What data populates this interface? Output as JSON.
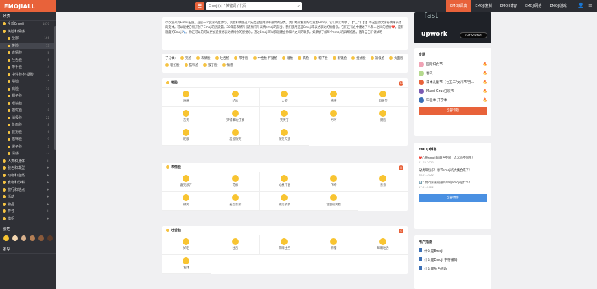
{
  "header": {
    "logo": "EMOJIALL",
    "search_placeholder": "Emoji(s) / 关键词 / 代码",
    "nav": [
      "EMOJI词典",
      "EMOJI复制",
      "EMOJI博客",
      "EMOJI网络",
      "EMOJI游戏"
    ]
  },
  "sidebar": {
    "section_title": "分类",
    "items": [
      {
        "label": "全部Emoji",
        "count": "1870",
        "type": "top"
      },
      {
        "label": "笑脸和情感",
        "count": "",
        "type": "top"
      },
      {
        "label": "全部",
        "count": "166",
        "type": "sub"
      },
      {
        "label": "笑脸",
        "count": "13",
        "type": "sub"
      },
      {
        "label": "表情脸",
        "count": "8",
        "type": "sub"
      },
      {
        "label": "吐舌脸",
        "count": "6",
        "type": "sub"
      },
      {
        "label": "带手脸",
        "count": "4",
        "type": "sub"
      },
      {
        "label": "中性脸-怀疑脸",
        "count": "12",
        "type": "sub"
      },
      {
        "label": "睡脸",
        "count": "5",
        "type": "sub"
      },
      {
        "label": "病脸",
        "count": "10",
        "type": "sub"
      },
      {
        "label": "帽子脸",
        "count": "1",
        "type": "sub"
      },
      {
        "label": "眼镜脸",
        "count": "3",
        "type": "sub"
      },
      {
        "label": "担忧脸",
        "count": "8",
        "type": "sub"
      },
      {
        "label": "消极脸",
        "count": "22",
        "type": "sub"
      },
      {
        "label": "负面脸",
        "count": "8",
        "type": "sub"
      },
      {
        "label": "装扮脸",
        "count": "6",
        "type": "sub"
      },
      {
        "label": "猫咪脸",
        "count": "9",
        "type": "sub"
      },
      {
        "label": "猴子脸",
        "count": "3",
        "type": "sub"
      },
      {
        "label": "情感",
        "count": "37",
        "type": "sub"
      },
      {
        "label": "人类和身体",
        "count": "",
        "type": "top"
      },
      {
        "label": "肤色和发型",
        "count": "",
        "type": "top"
      },
      {
        "label": "动物和自然",
        "count": "",
        "type": "top"
      },
      {
        "label": "食物和饮料",
        "count": "",
        "type": "top"
      },
      {
        "label": "旅行和地点",
        "count": "",
        "type": "top"
      },
      {
        "label": "活动",
        "count": "",
        "type": "top"
      },
      {
        "label": "物品",
        "count": "",
        "type": "top"
      },
      {
        "label": "符号",
        "count": "",
        "type": "top"
      },
      {
        "label": "旗帜",
        "count": "",
        "type": "top"
      }
    ],
    "skin_title": "肤色",
    "hair_title": "发型",
    "skin_colors": [
      "#f8c431",
      "#f3d6b0",
      "#d8b08c",
      "#b57f55",
      "#8a5a3b",
      "#5b3a29"
    ]
  },
  "intro": {
    "text": "😊欢迎来到Emoji王国。这是一个变家的世界😊。笑脸和情感这个分类是使用频率最高的分类。我们经常看到的😊爱脸Emoji。它们其实传承了【^_^】【;]】等这些原文字符情绪表达的变体。可以说便它们开创了Emoji的历史篇。30年前表情符号表情符号表情emoji的前身。我们使用这些Emoji来表达表达的情绪😊。它们还有之中建述了人和人之间的感情❤️。是有温度的Emoji🐾。你还可以的可以更加直接地表达情绪你的感觉😄。通过Emoji可以快速建立你和人之间的联系。如果想了解每个emoji的详细信息。戳单击它们试试吧~"
  },
  "subcats": {
    "label": "子分类:",
    "items": [
      "笑脸",
      "表情脸",
      "吐舌脸",
      "带手脸",
      "中性脸-怀疑脸",
      "睡脸",
      "病脸",
      "帽子脸",
      "眼镜脸",
      "担忧脸",
      "消极脸",
      "负面脸",
      "装扮脸",
      "猫咪脸",
      "猴子脸",
      "情感"
    ]
  },
  "sections": [
    {
      "title": "笑脸",
      "count": "13",
      "emojis": [
        "嘻嘻",
        "哈哈",
        "大笑",
        "嘻嘻",
        "斜眼笑",
        "苦笑",
        "笑得满地打滚",
        "笑哭了",
        "呵呵",
        "倒脸",
        "眨眼",
        "羞涩微笑",
        "微笑天使"
      ]
    },
    {
      "title": "表情脸",
      "count": "8",
      "emojis": [
        "喜笑颜开",
        "花痴",
        "好想开眉",
        "飞吻",
        "亲亲",
        "微笑",
        "羞涩亲亲",
        "微笑亲亲",
        "含泪的笑脸"
      ]
    },
    {
      "title": "吐舌脸",
      "count": "6",
      "emojis": [
        "好吃",
        "吐舌",
        "单眼吐舌",
        "滑稽",
        "眯眼吐舌",
        "发财"
      ]
    }
  ],
  "right": {
    "ad": {
      "top_text": "fast",
      "brand": "upwork",
      "cta": "Get Started"
    },
    "topics_title": "专题",
    "topics": [
      {
        "label": "国际妇女节",
        "color": "#f0a3b5"
      },
      {
        "label": "春天",
        "color": "#b5d98e"
      },
      {
        "label": "日本儿童节（七五三/女儿节/男...",
        "color": "#e8623a"
      },
      {
        "label": "Mardi Gras狂欢节",
        "color": "#7c5bb3"
      },
      {
        "label": "毕业季-开学季",
        "color": "#3b6fb5"
      }
    ],
    "topics_button": "全部专题",
    "blog_title": "EMOJI博客",
    "blogs": [
      {
        "title": "❤️心形emoji的颜色不同，含义也不同哦！",
        "date": "11.02.2022"
      },
      {
        "title": "🐼虎年快乐！春节emoji的大集合来了！",
        "date": "28.01.2022"
      },
      {
        "title": "⬆️？你可知道的最简单的emoji是什么？",
        "date": "17.01.2022"
      }
    ],
    "blog_button": "全部博客",
    "guide_title": "用户指南",
    "guides": [
      "什么是Emoji",
      "什么是Emoji 字符编码",
      "什么是肤色修改"
    ],
    "accent": "#e8623a",
    "blue": "#4a90e2"
  }
}
